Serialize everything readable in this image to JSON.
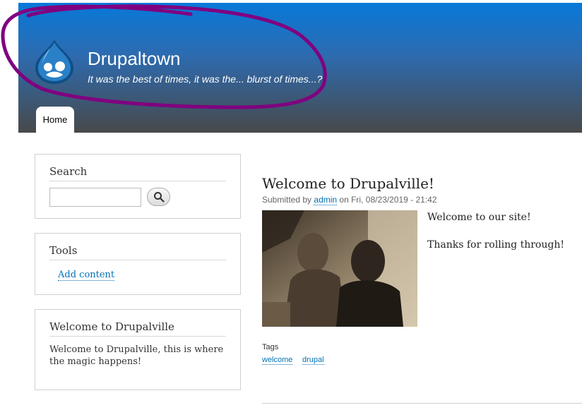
{
  "header": {
    "site_name": "Drupaltown",
    "slogan": "It was the best of times, it was the... blurst of times...?",
    "logo_icon": "drupal-drop-icon",
    "gradient_top": "#0779d9",
    "gradient_bottom": "#48494a",
    "annotation_color": "#800080"
  },
  "nav": {
    "tabs": [
      {
        "label": "Home"
      }
    ]
  },
  "sidebar": {
    "search": {
      "title": "Search",
      "input_value": "",
      "button_icon": "magnifier-icon"
    },
    "tools": {
      "title": "Tools",
      "links": [
        {
          "label": "Add content"
        }
      ]
    },
    "welcome": {
      "title": "Welcome to Drupalville",
      "text": "Welcome to Drupalville, this is where the magic happens!"
    }
  },
  "article": {
    "title": "Welcome to Drupalville!",
    "submitted_prefix": "Submitted by",
    "author": "admin",
    "submitted_date": "on Fri, 08/23/2019 - 21:42",
    "body": [
      "Welcome to our site!",
      "Thanks for rolling through!"
    ],
    "tags_label": "Tags",
    "tags": [
      "welcome",
      "drupal"
    ],
    "link_color": "#0071b3"
  }
}
